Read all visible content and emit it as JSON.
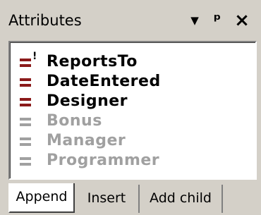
{
  "window": {
    "title": "Attributes",
    "dropdown_glyph": "▾",
    "pin_glyph": "ᵖ",
    "close_glyph": "✕"
  },
  "attributes": [
    {
      "name": "ReportsTo",
      "required": true,
      "primary": true
    },
    {
      "name": "DateEntered",
      "required": true
    },
    {
      "name": "Designer",
      "required": true
    },
    {
      "name": "Bonus",
      "required": false
    },
    {
      "name": "Manager",
      "required": false
    },
    {
      "name": "Programmer",
      "required": false
    }
  ],
  "tabs": [
    {
      "label": "Append",
      "active": true
    },
    {
      "label": "Insert",
      "active": false
    },
    {
      "label": "Add child",
      "active": false
    }
  ],
  "colors": {
    "required": "#8b1a1a",
    "optional": "#a0a0a0"
  }
}
